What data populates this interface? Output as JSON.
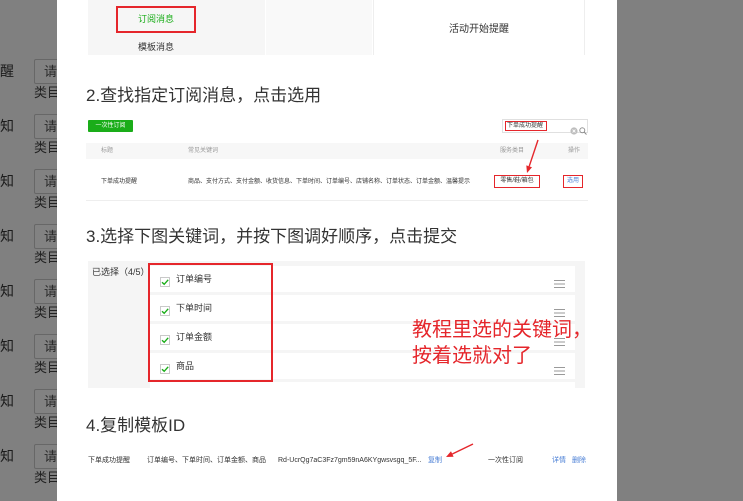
{
  "colors": {
    "overlay": "#808080",
    "accent_green": "#1aad19",
    "link_blue": "#4a7fd6",
    "annotation_red": "#e5262b"
  },
  "icons": {
    "search_clear": "clear-icon",
    "search": "search-icon",
    "keyword_check": "checkbox-checked-icon",
    "keyword_drag": "drag-handle-icon",
    "annotation_arrow": "arrow-icon"
  },
  "background_form": {
    "rows": [
      {
        "label": "醒",
        "input_text": "请",
        "category_label": "类目"
      },
      {
        "label": "知",
        "input_text": "请",
        "category_label": "类目"
      },
      {
        "label": "知",
        "input_text": "请",
        "category_label": "类目"
      },
      {
        "label": "知",
        "input_text": "请",
        "category_label": "类目"
      },
      {
        "label": "知",
        "input_text": "请",
        "category_label": "类目"
      },
      {
        "label": "知",
        "input_text": "请",
        "category_label": "类目"
      },
      {
        "label": "知",
        "input_text": "请",
        "category_label": "类目"
      },
      {
        "label": "知",
        "input_text": "请",
        "category_label": "类目"
      }
    ]
  },
  "modal": {
    "step1": {
      "nav_active": "订阅消息",
      "nav_item": "模板消息",
      "card_title": "活动开始提醒"
    },
    "step2": {
      "heading": "2.查找指定订阅消息，点击选用",
      "type_button": "一次性订阅",
      "search_value": "下单成功提醒",
      "table_headers": [
        "标题",
        "常见关键词",
        "服务类目",
        "操作"
      ],
      "row": {
        "title": "下单成功提醒",
        "keywords": "商品、支付方式、支付金额、收货信息、下单时间、订单编号、店铺名称、订单状态、订单金额、温馨提示",
        "category": "零售/鞋/箱包",
        "action": "选用"
      }
    },
    "step3": {
      "heading": "3.选择下图关键词，并按下图调好顺序，点击提交",
      "selected_label": "已选择（4/5）",
      "keywords": [
        "订单编号",
        "下单时间",
        "订单金额",
        "商品"
      ],
      "annotation": [
        "教程里选的关键词，",
        "按着选就对了"
      ]
    },
    "step4": {
      "heading": "4.复制模板ID",
      "row": {
        "title": "下单成功提醒",
        "keywords": "订单编号、下单时间、订单金额、商品",
        "template_id": "Rd-UcrQg7aC3Fz7gm59nA6KYgwsvsgq_5F...",
        "copy": "复制",
        "type": "一次性订阅",
        "detail": "详情",
        "delete": "删除"
      }
    }
  }
}
